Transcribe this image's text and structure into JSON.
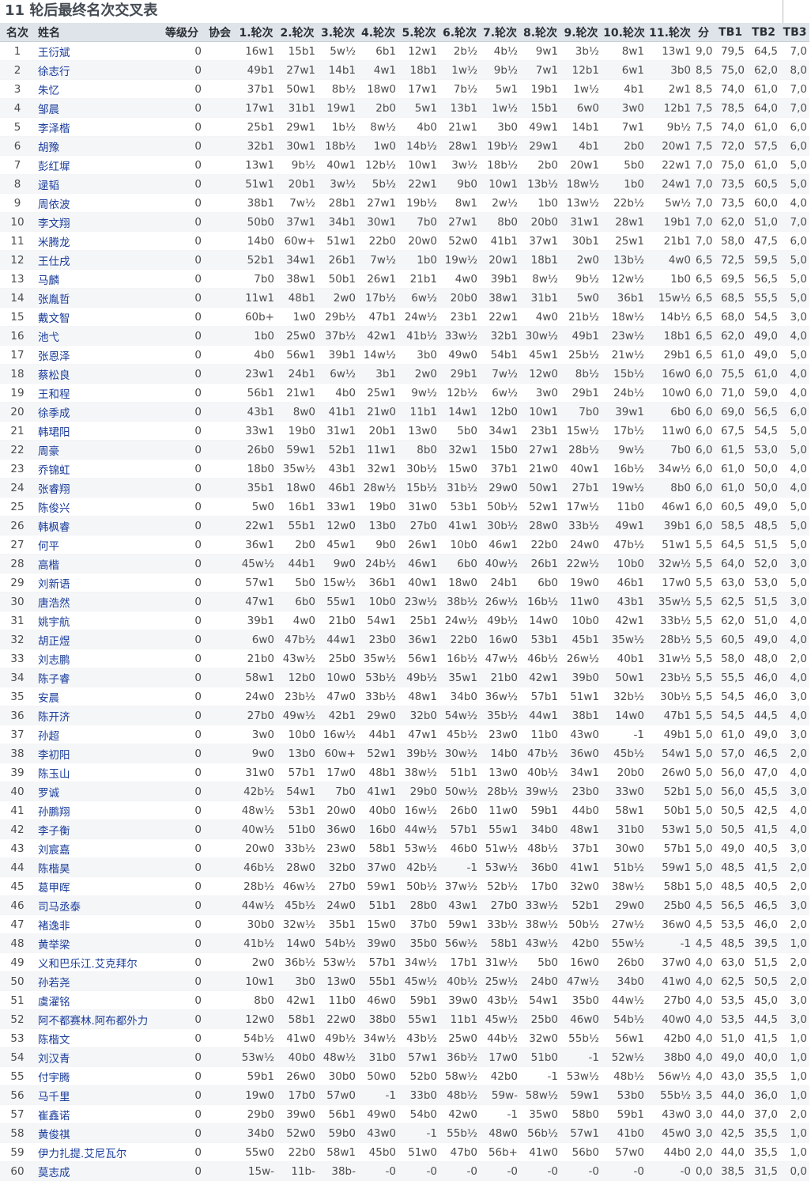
{
  "title": "11 轮后最终名次交叉表",
  "columns": [
    "名次",
    "姓名",
    "等级分",
    "协会",
    "1.轮次",
    "2.轮次",
    "3.轮次",
    "4.轮次",
    "5.轮次",
    "6.轮次",
    "7.轮次",
    "8.轮次",
    "9.轮次",
    "10.轮次",
    "11.轮次",
    "分",
    "TB1",
    "TB2",
    "TB3"
  ],
  "rows": [
    [
      "1",
      "王衍斌",
      "0",
      "",
      "16w1",
      "15b1",
      "5w½",
      "6b1",
      "12w1",
      "2b½",
      "4b½",
      "9w1",
      "3b½",
      "8w1",
      "13w1",
      "9,0",
      "79,5",
      "64,5",
      "7,0"
    ],
    [
      "2",
      "徐志行",
      "0",
      "",
      "49b1",
      "27w1",
      "14b1",
      "4w1",
      "18b1",
      "1w½",
      "9b½",
      "7w1",
      "12b1",
      "6w1",
      "3b0",
      "8,5",
      "75,0",
      "62,0",
      "8,0"
    ],
    [
      "3",
      "朱忆",
      "0",
      "",
      "37b1",
      "50w1",
      "8b½",
      "18w0",
      "17w1",
      "7b½",
      "5w1",
      "19b1",
      "1w½",
      "4b1",
      "2w1",
      "8,5",
      "74,0",
      "61,0",
      "7,0"
    ],
    [
      "4",
      "邹晨",
      "0",
      "",
      "17w1",
      "31b1",
      "19w1",
      "2b0",
      "5w1",
      "13b1",
      "1w½",
      "15b1",
      "6w0",
      "3w0",
      "12b1",
      "7,5",
      "78,5",
      "64,0",
      "7,0"
    ],
    [
      "5",
      "李泽楷",
      "0",
      "",
      "25b1",
      "29w1",
      "1b½",
      "8w½",
      "4b0",
      "21w1",
      "3b0",
      "49w1",
      "14b1",
      "7w1",
      "9b½",
      "7,5",
      "74,0",
      "61,0",
      "6,0"
    ],
    [
      "6",
      "胡豫",
      "0",
      "",
      "32b1",
      "30w1",
      "18b½",
      "1w0",
      "14b½",
      "28w1",
      "19b½",
      "29w1",
      "4b1",
      "2b0",
      "20w1",
      "7,5",
      "72,0",
      "57,5",
      "6,0"
    ],
    [
      "7",
      "彭红墀",
      "0",
      "",
      "13w1",
      "9b½",
      "40w1",
      "12b½",
      "10w1",
      "3w½",
      "18b½",
      "2b0",
      "20w1",
      "5b0",
      "22w1",
      "7,0",
      "75,0",
      "61,0",
      "5,0"
    ],
    [
      "8",
      "逯韬",
      "0",
      "",
      "51w1",
      "20b1",
      "3w½",
      "5b½",
      "22w1",
      "9b0",
      "10w1",
      "13b½",
      "18w½",
      "1b0",
      "24w1",
      "7,0",
      "73,5",
      "60,5",
      "5,0"
    ],
    [
      "9",
      "周依波",
      "0",
      "",
      "38b1",
      "7w½",
      "28b1",
      "27w1",
      "19b½",
      "8w1",
      "2w½",
      "1b0",
      "13w½",
      "22b½",
      "5w½",
      "7,0",
      "73,5",
      "60,0",
      "4,0"
    ],
    [
      "10",
      "李文翔",
      "0",
      "",
      "50b0",
      "37w1",
      "34b1",
      "30w1",
      "7b0",
      "27w1",
      "8b0",
      "20b0",
      "31w1",
      "28w1",
      "19b1",
      "7,0",
      "62,0",
      "51,0",
      "7,0"
    ],
    [
      "11",
      "米腾龙",
      "0",
      "",
      "14b0",
      "60w+",
      "51w1",
      "22b0",
      "20w0",
      "52w0",
      "41b1",
      "37w1",
      "30b1",
      "25w1",
      "21b1",
      "7,0",
      "58,0",
      "47,5",
      "6,0"
    ],
    [
      "12",
      "王仕戌",
      "0",
      "",
      "52b1",
      "34w1",
      "26b1",
      "7w½",
      "1b0",
      "19w½",
      "20w1",
      "18b1",
      "2w0",
      "13b½",
      "4w0",
      "6,5",
      "72,5",
      "59,5",
      "5,0"
    ],
    [
      "13",
      "马麟",
      "0",
      "",
      "7b0",
      "38w1",
      "50b1",
      "26w1",
      "21b1",
      "4w0",
      "39b1",
      "8w½",
      "9b½",
      "12w½",
      "1b0",
      "6,5",
      "69,5",
      "56,5",
      "5,0"
    ],
    [
      "14",
      "张胤哲",
      "0",
      "",
      "11w1",
      "48b1",
      "2w0",
      "17b½",
      "6w½",
      "20b0",
      "38w1",
      "31b1",
      "5w0",
      "36b1",
      "15w½",
      "6,5",
      "68,5",
      "55,5",
      "5,0"
    ],
    [
      "15",
      "戴文智",
      "0",
      "",
      "60b+",
      "1w0",
      "29b½",
      "47b1",
      "24w½",
      "23b1",
      "22w1",
      "4w0",
      "21b½",
      "18w½",
      "14b½",
      "6,5",
      "68,0",
      "54,5",
      "3,0"
    ],
    [
      "16",
      "池弋",
      "0",
      "",
      "1b0",
      "25w0",
      "37b½",
      "42w1",
      "41b½",
      "33w½",
      "32b1",
      "30w½",
      "49b1",
      "23w½",
      "18b1",
      "6,5",
      "62,0",
      "49,0",
      "4,0"
    ],
    [
      "17",
      "张恩泽",
      "0",
      "",
      "4b0",
      "56w1",
      "39b1",
      "14w½",
      "3b0",
      "49w0",
      "54b1",
      "45w1",
      "25b½",
      "21w½",
      "29b1",
      "6,5",
      "61,0",
      "49,0",
      "5,0"
    ],
    [
      "18",
      "蔡松良",
      "0",
      "",
      "23w1",
      "24b1",
      "6w½",
      "3b1",
      "2w0",
      "29b1",
      "7w½",
      "12w0",
      "8b½",
      "15b½",
      "16w0",
      "6,0",
      "75,5",
      "61,0",
      "4,0"
    ],
    [
      "19",
      "王和程",
      "0",
      "",
      "56b1",
      "21w1",
      "4b0",
      "25w1",
      "9w½",
      "12b½",
      "6w½",
      "3w0",
      "29b1",
      "24b½",
      "10w0",
      "6,0",
      "71,0",
      "59,0",
      "4,0"
    ],
    [
      "20",
      "徐季成",
      "0",
      "",
      "43b1",
      "8w0",
      "41b1",
      "21w0",
      "11b1",
      "14w1",
      "12b0",
      "10w1",
      "7b0",
      "39w1",
      "6b0",
      "6,0",
      "69,0",
      "56,5",
      "6,0"
    ],
    [
      "21",
      "韩珺阳",
      "0",
      "",
      "33w1",
      "19b0",
      "31w1",
      "20b1",
      "13w0",
      "5b0",
      "34w1",
      "23b1",
      "15w½",
      "17b½",
      "11w0",
      "6,0",
      "67,5",
      "54,5",
      "5,0"
    ],
    [
      "22",
      "周豪",
      "0",
      "",
      "26b0",
      "59w1",
      "52b1",
      "11w1",
      "8b0",
      "32w1",
      "15b0",
      "27w1",
      "28b½",
      "9w½",
      "7b0",
      "6,0",
      "61,5",
      "53,0",
      "5,0"
    ],
    [
      "23",
      "乔锦虹",
      "0",
      "",
      "18b0",
      "35w½",
      "43b1",
      "32w1",
      "30b½",
      "15w0",
      "37b1",
      "21w0",
      "40w1",
      "16b½",
      "34w½",
      "6,0",
      "61,0",
      "50,0",
      "4,0"
    ],
    [
      "24",
      "张睿翔",
      "0",
      "",
      "35b1",
      "18w0",
      "46b1",
      "28w½",
      "15b½",
      "31b½",
      "29w0",
      "50w1",
      "27b1",
      "19w½",
      "8b0",
      "6,0",
      "61,0",
      "50,0",
      "4,0"
    ],
    [
      "25",
      "陈俊兴",
      "0",
      "",
      "5w0",
      "16b1",
      "33w1",
      "19b0",
      "31w0",
      "53b1",
      "50b½",
      "52w1",
      "17w½",
      "11b0",
      "46w1",
      "6,0",
      "60,5",
      "49,0",
      "5,0"
    ],
    [
      "26",
      "韩枫睿",
      "0",
      "",
      "22w1",
      "55b1",
      "12w0",
      "13b0",
      "27b0",
      "41w1",
      "30b½",
      "28w0",
      "33b½",
      "49w1",
      "39b1",
      "6,0",
      "58,5",
      "48,5",
      "5,0"
    ],
    [
      "27",
      "何平",
      "0",
      "",
      "36w1",
      "2b0",
      "45w1",
      "9b0",
      "26w1",
      "10b0",
      "46w1",
      "22b0",
      "24w0",
      "47b½",
      "51w1",
      "5,5",
      "64,5",
      "51,5",
      "5,0"
    ],
    [
      "28",
      "高楷",
      "0",
      "",
      "45w½",
      "44b1",
      "9w0",
      "24b½",
      "46w1",
      "6b0",
      "40w½",
      "26b1",
      "22w½",
      "10b0",
      "32w½",
      "5,5",
      "64,0",
      "52,0",
      "3,0"
    ],
    [
      "29",
      "刘新语",
      "0",
      "",
      "57w1",
      "5b0",
      "15w½",
      "36b1",
      "40w1",
      "18w0",
      "24b1",
      "6b0",
      "19w0",
      "46b1",
      "17w0",
      "5,5",
      "63,0",
      "53,0",
      "5,0"
    ],
    [
      "30",
      "唐浩然",
      "0",
      "",
      "47w1",
      "6b0",
      "55w1",
      "10b0",
      "23w½",
      "38b½",
      "26w½",
      "16b½",
      "11w0",
      "43b1",
      "35w½",
      "5,5",
      "62,5",
      "51,5",
      "3,0"
    ],
    [
      "31",
      "姚宇航",
      "0",
      "",
      "39b1",
      "4w0",
      "21b0",
      "54w1",
      "25b1",
      "24w½",
      "49b½",
      "14w0",
      "10b0",
      "42w1",
      "33b½",
      "5,5",
      "62,0",
      "51,0",
      "4,0"
    ],
    [
      "32",
      "胡正煜",
      "0",
      "",
      "6w0",
      "47b½",
      "44w1",
      "23b0",
      "36w1",
      "22b0",
      "16w0",
      "53b1",
      "45b1",
      "35w½",
      "28b½",
      "5,5",
      "60,5",
      "49,0",
      "4,0"
    ],
    [
      "33",
      "刘志鹏",
      "0",
      "",
      "21b0",
      "43w½",
      "25b0",
      "35w½",
      "56w1",
      "16b½",
      "47w½",
      "46b½",
      "26w½",
      "40b1",
      "31w½",
      "5,5",
      "58,0",
      "48,0",
      "2,0"
    ],
    [
      "34",
      "陈子睿",
      "0",
      "",
      "58w1",
      "12b0",
      "10w0",
      "53b½",
      "49b½",
      "35w1",
      "21b0",
      "42w1",
      "39b0",
      "50w1",
      "23b½",
      "5,5",
      "55,5",
      "46,0",
      "4,0"
    ],
    [
      "35",
      "安晨",
      "0",
      "",
      "24w0",
      "23b½",
      "47w0",
      "33b½",
      "48w1",
      "34b0",
      "36w½",
      "57b1",
      "51w1",
      "32b½",
      "30b½",
      "5,5",
      "54,5",
      "46,0",
      "3,0"
    ],
    [
      "36",
      "陈开济",
      "0",
      "",
      "27b0",
      "49w½",
      "42b1",
      "29w0",
      "32b0",
      "54w½",
      "35b½",
      "44w1",
      "38b1",
      "14w0",
      "47b1",
      "5,5",
      "54,5",
      "44,5",
      "4,0"
    ],
    [
      "37",
      "孙超",
      "0",
      "",
      "3w0",
      "10b0",
      "16w½",
      "44b1",
      "47w1",
      "45b½",
      "23w0",
      "11b0",
      "43w0",
      "-1",
      "49b1",
      "5,0",
      "61,0",
      "49,0",
      "3,0"
    ],
    [
      "38",
      "李初阳",
      "0",
      "",
      "9w0",
      "13b0",
      "60w+",
      "52w1",
      "39b½",
      "30w½",
      "14b0",
      "47b½",
      "36w0",
      "45b½",
      "54w1",
      "5,0",
      "57,0",
      "46,5",
      "2,0"
    ],
    [
      "39",
      "陈玉山",
      "0",
      "",
      "31w0",
      "57b1",
      "17w0",
      "48b1",
      "38w½",
      "51b1",
      "13w0",
      "40b½",
      "34w1",
      "20b0",
      "26w0",
      "5,0",
      "56,0",
      "47,0",
      "4,0"
    ],
    [
      "40",
      "罗诚",
      "0",
      "",
      "42b½",
      "54w1",
      "7b0",
      "41w1",
      "29b0",
      "50w½",
      "28b½",
      "39w½",
      "23b0",
      "33w0",
      "52b1",
      "5,0",
      "56,0",
      "45,5",
      "3,0"
    ],
    [
      "41",
      "孙鹏翔",
      "0",
      "",
      "48w½",
      "53b1",
      "20w0",
      "40b0",
      "16w½",
      "26b0",
      "11w0",
      "59b1",
      "44b0",
      "58w1",
      "50b1",
      "5,0",
      "50,5",
      "42,5",
      "4,0"
    ],
    [
      "42",
      "李子衡",
      "0",
      "",
      "40w½",
      "51b0",
      "36w0",
      "16b0",
      "44w½",
      "57b1",
      "55w1",
      "34b0",
      "48w1",
      "31b0",
      "53w1",
      "5,0",
      "50,5",
      "41,5",
      "4,0"
    ],
    [
      "43",
      "刘宸嘉",
      "0",
      "",
      "20w0",
      "33b½",
      "23w0",
      "58b1",
      "53w½",
      "46b0",
      "51w½",
      "48b½",
      "37b1",
      "30w0",
      "57b1",
      "5,0",
      "49,0",
      "40,5",
      "3,0"
    ],
    [
      "44",
      "陈楷昊",
      "0",
      "",
      "46b½",
      "28w0",
      "32b0",
      "37w0",
      "42b½",
      "-1",
      "53w½",
      "36b0",
      "41w1",
      "51b½",
      "59w1",
      "5,0",
      "48,5",
      "41,5",
      "2,0"
    ],
    [
      "45",
      "葛甲晖",
      "0",
      "",
      "28b½",
      "46w½",
      "27b0",
      "59w1",
      "50b½",
      "37w½",
      "52b½",
      "17b0",
      "32w0",
      "38w½",
      "58b1",
      "5,0",
      "48,5",
      "40,5",
      "2,0"
    ],
    [
      "46",
      "司马丞泰",
      "0",
      "",
      "44w½",
      "45b½",
      "24w0",
      "51b1",
      "28b0",
      "43w1",
      "27b0",
      "33w½",
      "52b1",
      "29w0",
      "25b0",
      "4,5",
      "56,5",
      "46,5",
      "3,0"
    ],
    [
      "47",
      "褚逸非",
      "0",
      "",
      "30b0",
      "32w½",
      "35b1",
      "15w0",
      "37b0",
      "59w1",
      "33b½",
      "38w½",
      "50b½",
      "27w½",
      "36w0",
      "4,5",
      "53,5",
      "46,0",
      "2,0"
    ],
    [
      "48",
      "黄举梁",
      "0",
      "",
      "41b½",
      "14w0",
      "54b½",
      "39w0",
      "35b0",
      "56w½",
      "58b1",
      "43w½",
      "42b0",
      "55w½",
      "-1",
      "4,5",
      "48,5",
      "39,5",
      "1,0"
    ],
    [
      "49",
      "义和巴乐江.艾克拜尔",
      "0",
      "",
      "2w0",
      "36b½",
      "53w½",
      "57b1",
      "34w½",
      "17b1",
      "31w½",
      "5b0",
      "16w0",
      "26b0",
      "37w0",
      "4,0",
      "63,0",
      "51,5",
      "2,0"
    ],
    [
      "50",
      "孙若尧",
      "0",
      "",
      "10w1",
      "3b0",
      "13w0",
      "55b1",
      "45w½",
      "40b½",
      "25w½",
      "24b0",
      "47w½",
      "34b0",
      "41w0",
      "4,0",
      "62,5",
      "50,5",
      "2,0"
    ],
    [
      "51",
      "虞濯铭",
      "0",
      "",
      "8b0",
      "42w1",
      "11b0",
      "46w0",
      "59b1",
      "39w0",
      "43b½",
      "54w1",
      "35b0",
      "44w½",
      "27b0",
      "4,0",
      "53,5",
      "45,0",
      "3,0"
    ],
    [
      "52",
      "阿不都赛林.阿布都外力",
      "0",
      "",
      "12w0",
      "58b1",
      "22w0",
      "38b0",
      "55w1",
      "11b1",
      "45w½",
      "25b0",
      "46w0",
      "54b½",
      "40w0",
      "4,0",
      "53,5",
      "44,5",
      "3,0"
    ],
    [
      "53",
      "陈楷文",
      "0",
      "",
      "54b½",
      "41w0",
      "49b½",
      "34w½",
      "43b½",
      "25w0",
      "44b½",
      "32w0",
      "55b½",
      "56w1",
      "42b0",
      "4,0",
      "51,0",
      "41,5",
      "1,0"
    ],
    [
      "54",
      "刘汉青",
      "0",
      "",
      "53w½",
      "40b0",
      "48w½",
      "31b0",
      "57w1",
      "36b½",
      "17w0",
      "51b0",
      "-1",
      "52w½",
      "38b0",
      "4,0",
      "49,0",
      "40,0",
      "1,0"
    ],
    [
      "55",
      "付宇腾",
      "0",
      "",
      "59b1",
      "26w0",
      "30b0",
      "50w0",
      "52b0",
      "58w½",
      "42b0",
      "-1",
      "53w½",
      "48b½",
      "56w½",
      "4,0",
      "43,0",
      "35,5",
      "1,0"
    ],
    [
      "56",
      "马千里",
      "0",
      "",
      "19w0",
      "17b0",
      "57w0",
      "-1",
      "33b0",
      "48b½",
      "59w-",
      "58w½",
      "59w1",
      "53b0",
      "55b½",
      "3,5",
      "44,0",
      "36,0",
      "1,0"
    ],
    [
      "57",
      "崔鑫诺",
      "0",
      "",
      "29b0",
      "39w0",
      "56b1",
      "49w0",
      "54b0",
      "42w0",
      "-1",
      "35w0",
      "58b0",
      "59b1",
      "43w0",
      "3,0",
      "44,0",
      "37,0",
      "2,0"
    ],
    [
      "58",
      "黄俊祺",
      "0",
      "",
      "34b0",
      "52w0",
      "59b0",
      "43w0",
      "-1",
      "55b½",
      "48w0",
      "56b½",
      "57w1",
      "41b0",
      "45w0",
      "3,0",
      "42,5",
      "35,5",
      "1,0"
    ],
    [
      "59",
      "伊力扎提.艾尼瓦尔",
      "0",
      "",
      "55w0",
      "22b0",
      "58w1",
      "45b0",
      "51w0",
      "47b0",
      "56b+",
      "41w0",
      "56b0",
      "57w0",
      "44b0",
      "2,0",
      "44,0",
      "35,5",
      "1,0"
    ],
    [
      "60",
      "莫志成",
      "0",
      "",
      "15w-",
      "11b-",
      "38b-",
      "-0",
      "-0",
      "-0",
      "-0",
      "-0",
      "-0",
      "-0",
      "-0",
      "0,0",
      "38,5",
      "31,5",
      "0,0"
    ]
  ]
}
